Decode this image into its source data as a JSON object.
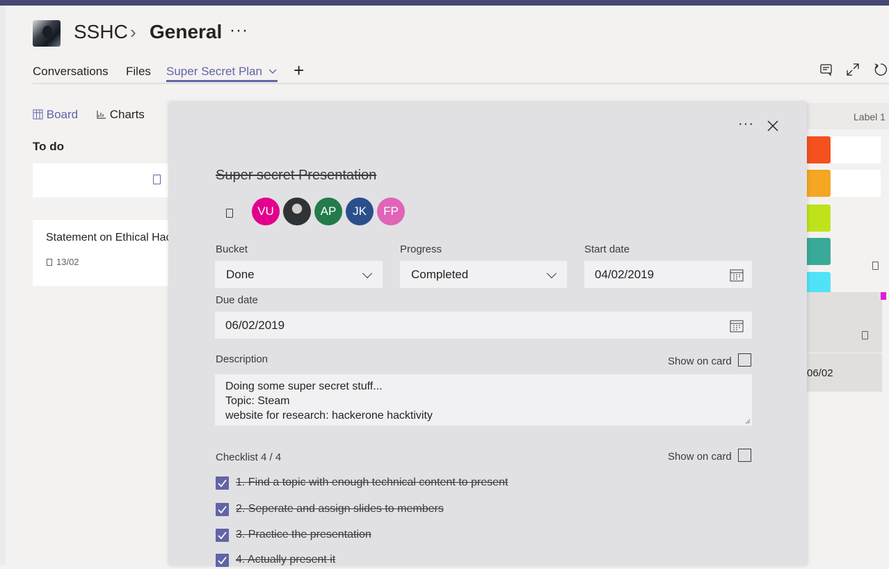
{
  "header": {
    "team": "SSHC",
    "channel": "General",
    "more": "···"
  },
  "tabs": [
    {
      "label": "Conversations"
    },
    {
      "label": "Files"
    },
    {
      "label": "Super Secret Plan"
    }
  ],
  "views": [
    {
      "label": "Board"
    },
    {
      "label": "Charts"
    }
  ],
  "right_panel": {
    "label_heading": "Label 1",
    "card_date": "06/02",
    "label_colors": [
      "#f4511e",
      "#f5a623",
      "#bfe31b",
      "#39aa98",
      "#50e3f8"
    ]
  },
  "board": {
    "bucket_title": "To do",
    "task_card": {
      "title": "Statement on Ethical Hacking",
      "date": "13/02"
    }
  },
  "task_dialog": {
    "more": "···",
    "title": "Super secret Presentation",
    "assignees": [
      {
        "initials": "VU",
        "color": "#e3008c"
      },
      {
        "initials": "",
        "color": "#2f3336",
        "photo": true
      },
      {
        "initials": "AP",
        "color": "#237b4b"
      },
      {
        "initials": "JK",
        "color": "#2b4f8c"
      },
      {
        "initials": "FP",
        "color": "#e064b7"
      }
    ],
    "fields": {
      "bucket_label": "Bucket",
      "bucket_value": "Done",
      "progress_label": "Progress",
      "progress_value": "Completed",
      "start_label": "Start date",
      "start_value": "04/02/2019",
      "due_label": "Due date",
      "due_value": "06/02/2019"
    },
    "description": {
      "label": "Description",
      "show_on_card": "Show on card",
      "lines": [
        "Doing some super secret stuff...",
        "Topic: Steam",
        "website for research: hackerone hacktivity"
      ]
    },
    "checklist": {
      "label": "Checklist 4 / 4",
      "show_on_card": "Show on card",
      "items": [
        {
          "text": "1. Find a topic with enough technical content to present",
          "checked": true
        },
        {
          "text": "2. Seperate and assign slides to members",
          "checked": true
        },
        {
          "text": "3. Practice the presentation",
          "checked": true
        },
        {
          "text": "4. Actually present it",
          "checked": true
        }
      ]
    }
  }
}
